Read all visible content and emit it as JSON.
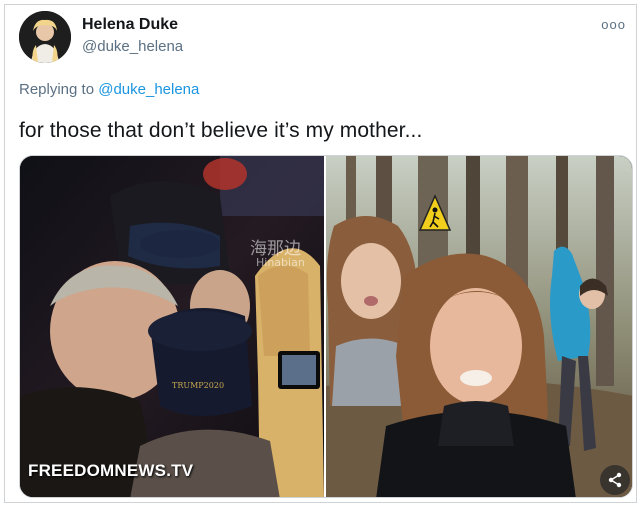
{
  "author": {
    "name": "Helena Duke",
    "handle": "@duke_helena"
  },
  "menu": {
    "more_icon": "more-options-icon",
    "more_label": "ooo"
  },
  "reply": {
    "prefix": "Replying to ",
    "to_handle": "@duke_helena"
  },
  "tweet": {
    "text": "for those that don’t believe it’s my mother..."
  },
  "media": {
    "left_photo": {
      "watermark": "FREEDOMNEWS.TV",
      "overlay_cn": "海那边",
      "overlay_en": "Hinabian",
      "cap_text": "TRUMP2020"
    },
    "right_photo": {
      "sign_icon": "hiker-warning-sign-icon"
    },
    "share_icon": "share-icon"
  },
  "colors": {
    "link": "#1b95e0",
    "secondary_text": "#5b7083",
    "border": "#cfd3d6"
  }
}
